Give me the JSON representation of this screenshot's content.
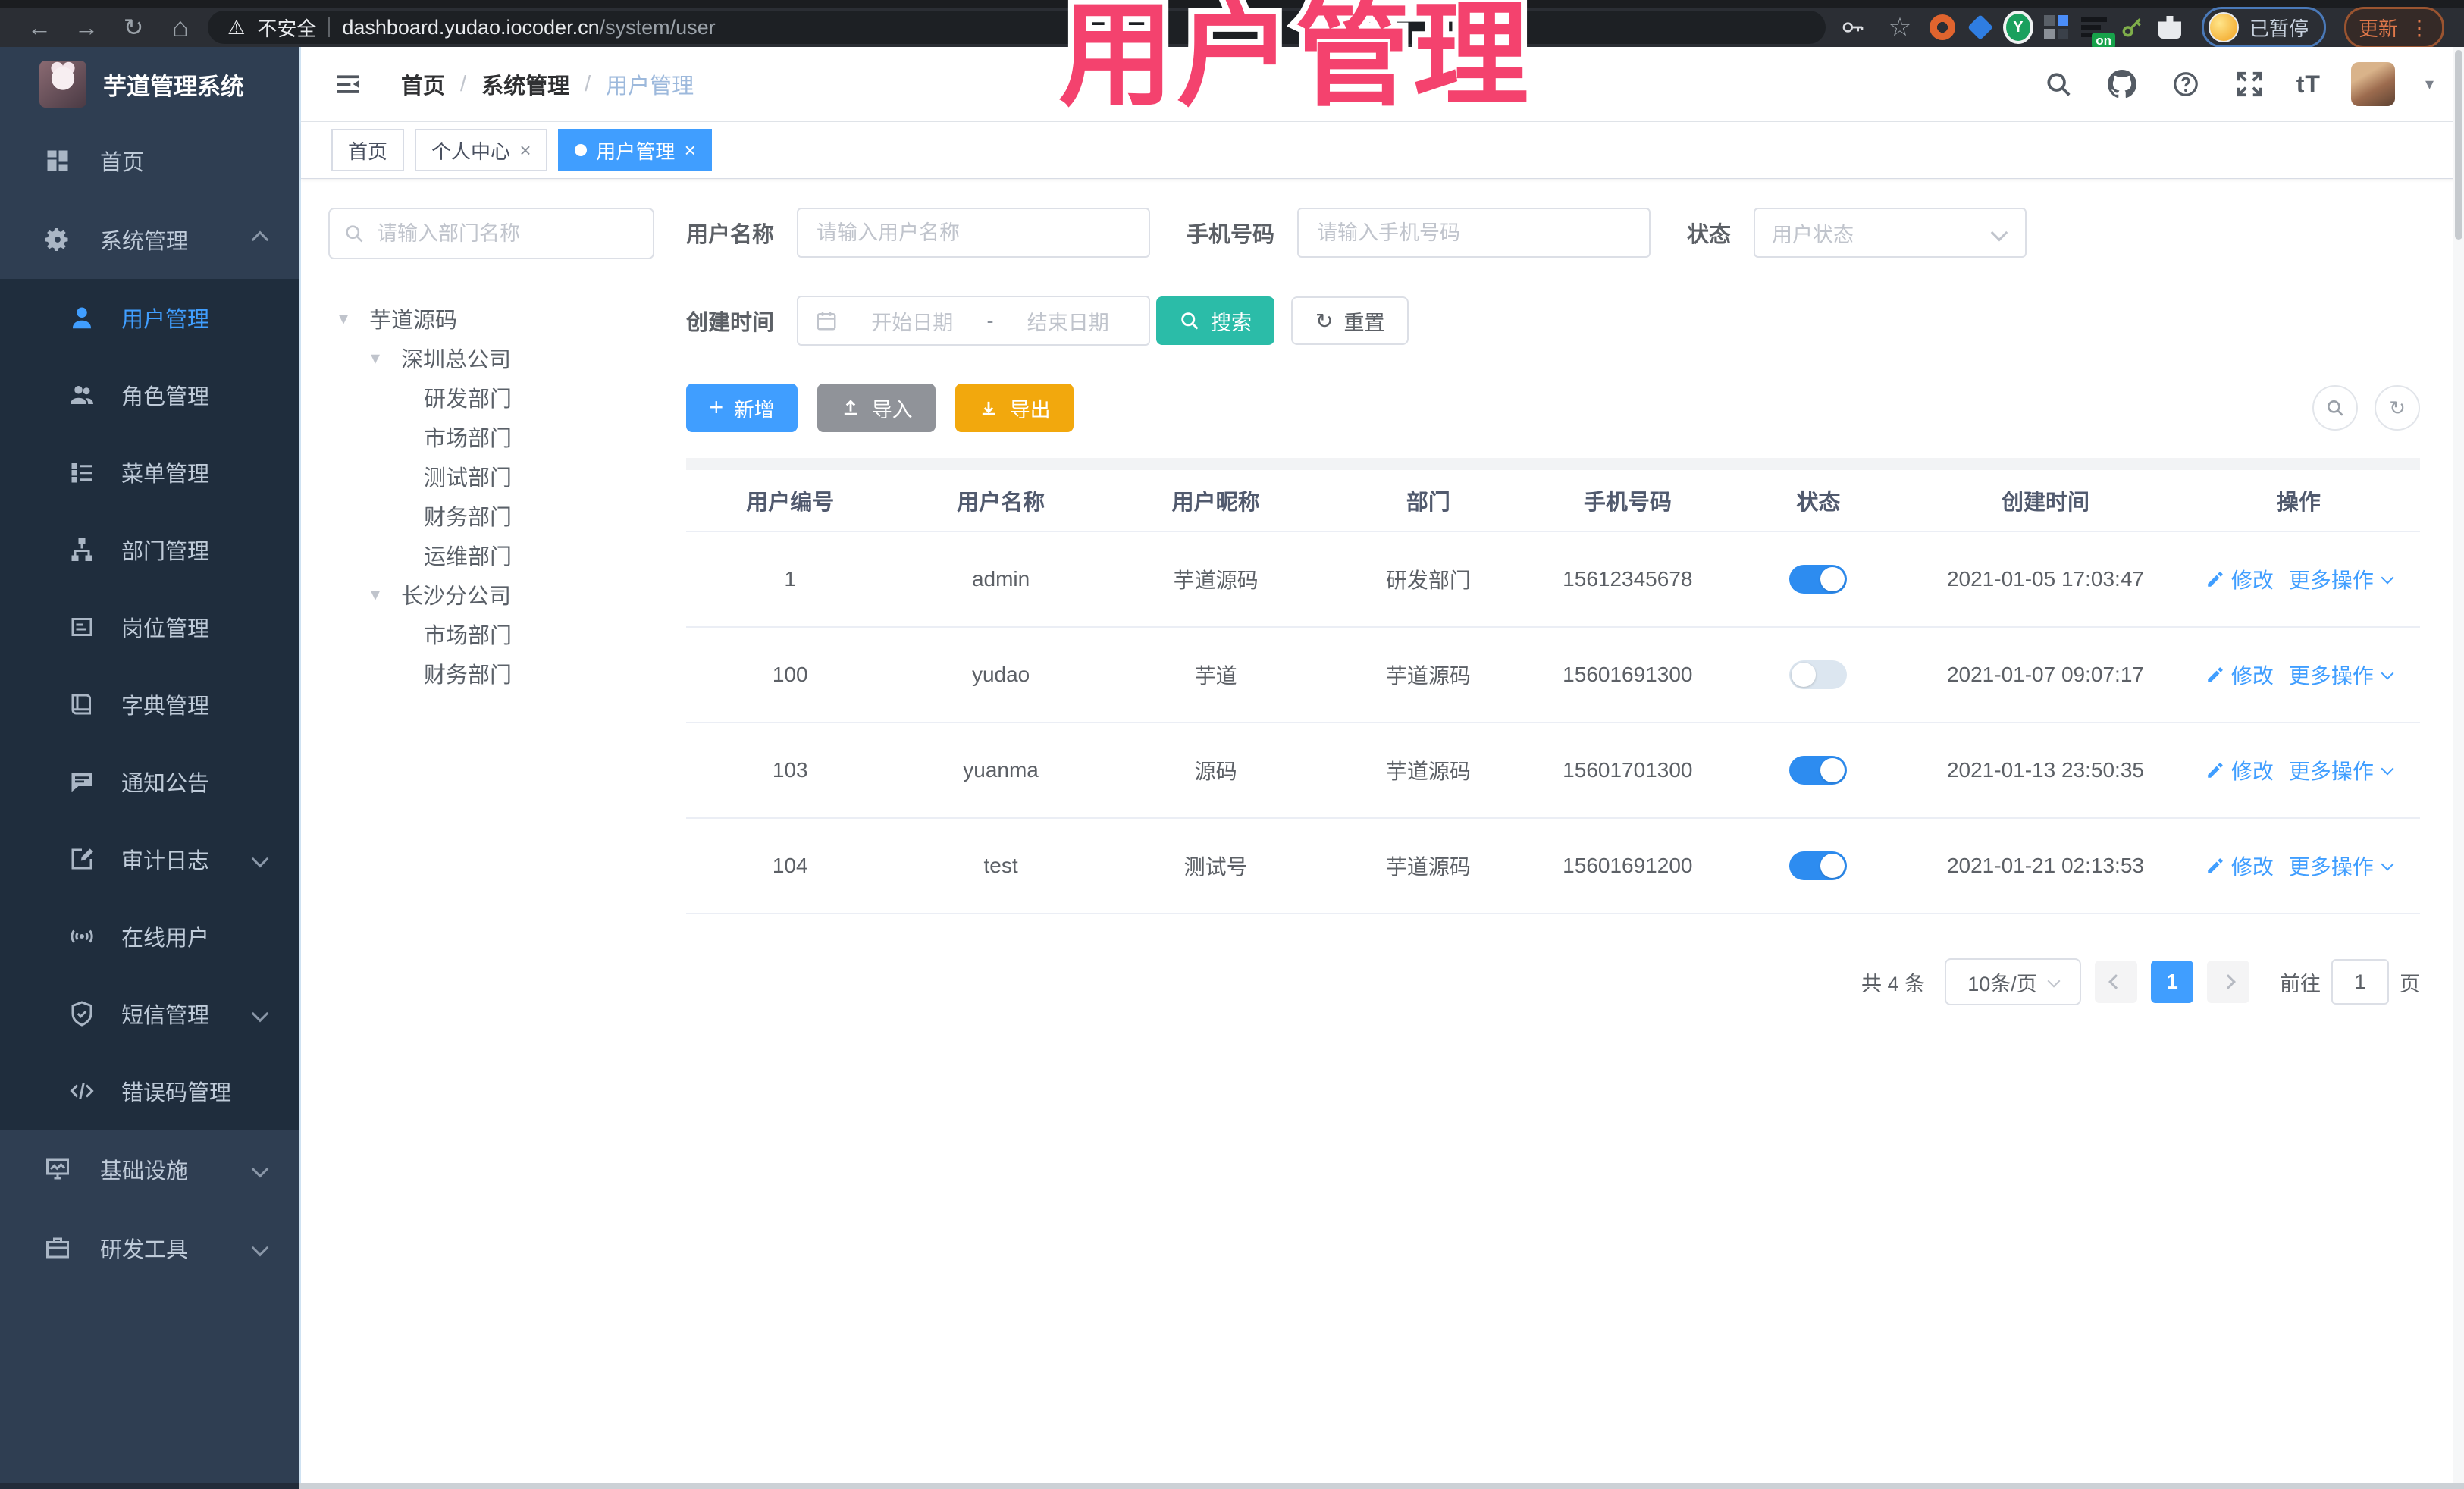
{
  "colors": {
    "primary": "#409eff",
    "toggle_on": "#2d8cf0",
    "search_teal": "#2bbca8",
    "export_amber": "#f2a80d",
    "import_gray": "#909399",
    "overlay_pink": "#f4426e",
    "sidebar_bg": "#2f3e52",
    "submenu_bg": "#1f2d3d",
    "sidebar_text": "#bfcbd9"
  },
  "browser": {
    "insecure_label": "不安全",
    "url_host": "dashboard.yudao.iocoder.cn",
    "url_path": "/system/user",
    "ext_on_badge": "on",
    "profile_status": "已暂停",
    "update_label": "更新"
  },
  "overlay_title": "用户管理",
  "sidebar": {
    "app_title": "芋道管理系统",
    "home_label": "首页",
    "system": {
      "label": "系统管理",
      "children": [
        {
          "label": "用户管理"
        },
        {
          "label": "角色管理"
        },
        {
          "label": "菜单管理"
        },
        {
          "label": "部门管理"
        },
        {
          "label": "岗位管理"
        },
        {
          "label": "字典管理"
        },
        {
          "label": "通知公告"
        },
        {
          "label": "审计日志"
        },
        {
          "label": "在线用户"
        },
        {
          "label": "短信管理"
        },
        {
          "label": "错误码管理"
        }
      ]
    },
    "infra_label": "基础设施",
    "devtools_label": "研发工具"
  },
  "header": {
    "breadcrumb": [
      "首页",
      "系统管理",
      "用户管理"
    ],
    "font_icon_label": "tT"
  },
  "tags": [
    {
      "label": "首页",
      "closable": false,
      "active": false
    },
    {
      "label": "个人中心",
      "closable": true,
      "active": false
    },
    {
      "label": "用户管理",
      "closable": true,
      "active": true
    }
  ],
  "tree": {
    "placeholder": "请输入部门名称",
    "nodes": [
      {
        "label": "芋道源码",
        "level": 0,
        "expanded": true
      },
      {
        "label": "深圳总公司",
        "level": 1,
        "expanded": true
      },
      {
        "label": "研发部门",
        "level": 2
      },
      {
        "label": "市场部门",
        "level": 2
      },
      {
        "label": "测试部门",
        "level": 2
      },
      {
        "label": "财务部门",
        "level": 2
      },
      {
        "label": "运维部门",
        "level": 2
      },
      {
        "label": "长沙分公司",
        "level": 1,
        "expanded": true
      },
      {
        "label": "市场部门",
        "level": 2
      },
      {
        "label": "财务部门",
        "level": 2
      }
    ]
  },
  "filters": {
    "username_label": "用户名称",
    "username_placeholder": "请输入用户名称",
    "mobile_label": "手机号码",
    "mobile_placeholder": "请输入手机号码",
    "status_label": "状态",
    "status_placeholder": "用户状态",
    "date_label": "创建时间",
    "date_start": "开始日期",
    "date_sep": "-",
    "date_end": "结束日期",
    "search_label": "搜索",
    "reset_label": "重置"
  },
  "toolbar": {
    "add": "新增",
    "import": "导入",
    "export": "导出"
  },
  "table": {
    "columns": [
      "用户编号",
      "用户名称",
      "用户昵称",
      "部门",
      "手机号码",
      "状态",
      "创建时间",
      "操作"
    ],
    "actions": {
      "edit": "修改",
      "more": "更多操作"
    },
    "rows": [
      {
        "id": "1",
        "username": "admin",
        "nickname": "芋道源码",
        "dept": "研发部门",
        "mobile": "15612345678",
        "status": "on",
        "created": "2021-01-05 17:03:47"
      },
      {
        "id": "100",
        "username": "yudao",
        "nickname": "芋道",
        "dept": "芋道源码",
        "mobile": "15601691300",
        "status": "off",
        "created": "2021-01-07 09:07:17"
      },
      {
        "id": "103",
        "username": "yuanma",
        "nickname": "源码",
        "dept": "芋道源码",
        "mobile": "15601701300",
        "status": "on",
        "created": "2021-01-13 23:50:35"
      },
      {
        "id": "104",
        "username": "test",
        "nickname": "测试号",
        "dept": "芋道源码",
        "mobile": "15601691200",
        "status": "on",
        "created": "2021-01-21 02:13:53"
      }
    ]
  },
  "pagination": {
    "total": "共 4 条",
    "page_size": "10条/页",
    "page": "1",
    "goto_label": "前往",
    "goto_value": "1",
    "unit_label": "页"
  }
}
